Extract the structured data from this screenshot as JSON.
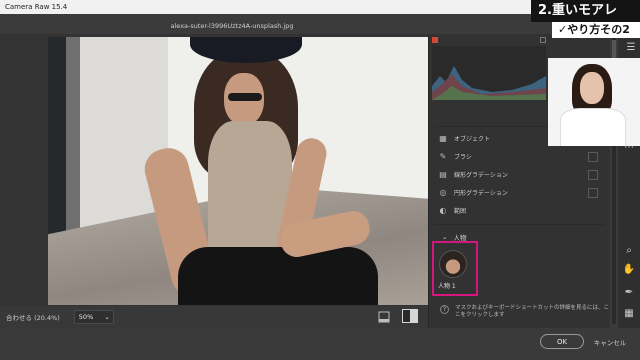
{
  "window": {
    "title": "Camera Raw 15.4",
    "controls": [
      "—",
      "□",
      "✕"
    ]
  },
  "file": {
    "name": "alexa-suter-l3996Uztz4A-unsplash.jpg"
  },
  "bottombar": {
    "fit_label": "合わせる (20.4%)",
    "zoom_value": "50%",
    "zoom_arrow": "⌄"
  },
  "panel": {
    "tools": [
      {
        "label": "オブジェクト",
        "icon": "object-selection-icon",
        "glyph": "▦"
      },
      {
        "label": "ブラシ",
        "icon": "brush-icon",
        "glyph": "✎"
      },
      {
        "label": "線形グラデーション",
        "icon": "linear-gradient-icon",
        "glyph": "▤"
      },
      {
        "label": "円形グラデーション",
        "icon": "radial-gradient-icon",
        "glyph": "◎"
      },
      {
        "label": "範囲",
        "icon": "range-mask-icon",
        "glyph": "◐"
      }
    ],
    "people_section": "人物",
    "person": {
      "label": "人物 1"
    },
    "info_text": "マスクおよびキーボードショートカットの詳細を見るには、ここをクリックします"
  },
  "overlay": {
    "banner": "2.重いモアレ",
    "subbanner": "✓やり方その2"
  },
  "footer": {
    "ok": "OK",
    "cancel": "キャンセル"
  },
  "colors": {
    "accent": "#d4177f",
    "panel_bg": "#323232"
  }
}
